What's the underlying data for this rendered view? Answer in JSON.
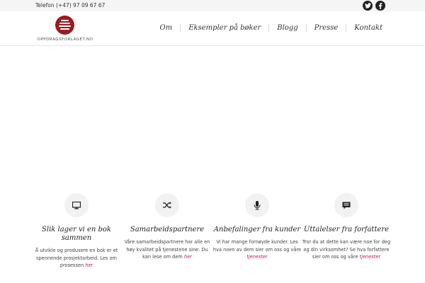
{
  "topbar": {
    "phone": "Telefon (+47) 97 09 67 67",
    "social": [
      {
        "icon": "twitter-icon"
      },
      {
        "icon": "facebook-icon"
      }
    ]
  },
  "brand": {
    "logo_text": "OPPDRAGSFORLAGET.NO",
    "accent": "#9b1b20"
  },
  "nav": {
    "items": [
      "Om",
      "Eksempler på bøker",
      "Blogg",
      "Presse",
      "Kontakt"
    ]
  },
  "features": [
    {
      "icon": "monitor-icon",
      "title": "Slik lager vi en bok sammen",
      "text": "Å utvikle og produsere en bok er et spennende prosjektarbeid. Les om prosessen ",
      "link": "her"
    },
    {
      "icon": "shuffle-icon",
      "title": "Samarbeidspartnere",
      "text": "Våre samarbeidspartnere har alle en høy kvalitet på tjenestene sine. Du kan lese om dem ",
      "link": "her"
    },
    {
      "icon": "microphone-icon",
      "title": "Anbefalinger fra kunder",
      "text": "Vi har mange fornøyde kunder. Les hva noen av dem sier om oss og våre ",
      "link": "tjenester"
    },
    {
      "icon": "speech-bubble-icon",
      "title": "Uttalelser fra forfattere",
      "text": "Tror du at dette kan være noe for deg og din virksomhet? Se hva forfattere sier om oss og våre ",
      "link": "tjenester"
    }
  ],
  "link_color": "#c0184e"
}
